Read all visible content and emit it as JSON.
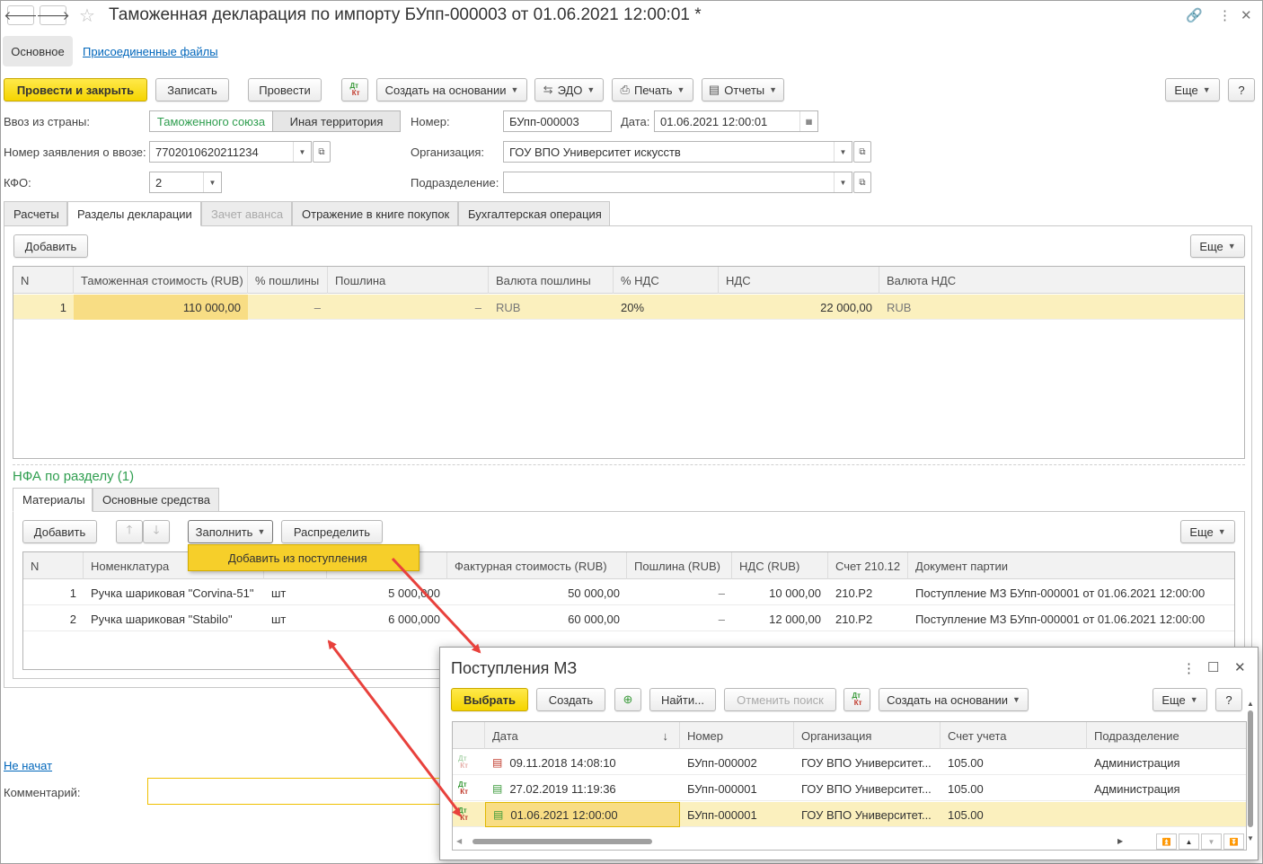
{
  "window": {
    "title": "Таможенная декларация по импорту БУпп-000003 от 01.06.2021 12:00:01 *"
  },
  "nav": {
    "back_glyph": "🡐",
    "forward_glyph": "🡒",
    "star_glyph": "☆",
    "link_glyph": "🔗",
    "menu_glyph": "⋮",
    "maximize_glyph": "☐",
    "close_glyph": "✕"
  },
  "form_tabs": {
    "main": "Основное",
    "files": "Присоединенные файлы"
  },
  "toolbar": {
    "post_close": "Провести и закрыть",
    "save": "Записать",
    "post": "Провести",
    "dtkt": "Дт Кт",
    "create_based": "Создать на основании",
    "edo": "ЭДО",
    "print": "Печать",
    "reports": "Отчеты",
    "more": "Еще",
    "help": "?"
  },
  "fields": {
    "import_country_label": "Ввоз из страны:",
    "customs_union": "Таможенного союза",
    "other_territory": "Иная территория",
    "application_label": "Номер заявления о ввозе:",
    "application_value": "7702010620211234",
    "kfo_label": "КФО:",
    "kfo_value": "2",
    "number_label": "Номер:",
    "number_value": "БУпп-000003",
    "date_label": "Дата:",
    "date_value": "01.06.2021 12:00:01",
    "org_label": "Организация:",
    "org_value": "ГОУ ВПО Университет искусств",
    "dept_label": "Подразделение:",
    "dept_value": ""
  },
  "tabs": [
    "Расчеты",
    "Разделы декларации",
    "Зачет аванса",
    "Отражение в книге покупок",
    "Бухгалтерская операция"
  ],
  "sections": {
    "add": "Добавить",
    "more": "Еще",
    "columns": [
      "N",
      "Таможенная стоимость (RUB)",
      "% пошлины",
      "Пошлина",
      "Валюта пошлины",
      "% НДС",
      "НДС",
      "Валюта НДС"
    ],
    "rows": [
      {
        "n": "1",
        "value": "110 000,00",
        "duty_pct": "–",
        "duty": "–",
        "duty_cur": "RUB",
        "vat_pct": "20%",
        "vat": "22 000,00",
        "vat_cur": "RUB"
      }
    ]
  },
  "nfa": {
    "title": "НФА по разделу (1)",
    "tabs": [
      "Материалы",
      "Основные средства"
    ],
    "add": "Добавить",
    "fill": "Заполнить",
    "distribute": "Распределить",
    "more": "Еще",
    "fill_menu_item": "Добавить из поступления",
    "columns": [
      "N",
      "Номенклатура",
      "",
      "",
      "Фактурная стоимость (RUB)",
      "Пошлина (RUB)",
      "НДС (RUB)",
      "Счет 210.12",
      "Документ партии"
    ],
    "rows": [
      {
        "n": "1",
        "name": "Ручка шариковая \"Corvina-51\"",
        "unit": "шт",
        "qty": "5 000,000",
        "invoice": "50 000,00",
        "duty": "–",
        "vat": "10 000,00",
        "account": "210.Р2",
        "doc": "Поступление МЗ БУпп-000001 от 01.06.2021 12:00:00"
      },
      {
        "n": "2",
        "name": "Ручка шариковая \"Stabilo\"",
        "unit": "шт",
        "qty": "6 000,000",
        "invoice": "60 000,00",
        "duty": "–",
        "vat": "12 000,00",
        "account": "210.Р2",
        "doc": "Поступление МЗ БУпп-000001 от 01.06.2021 12:00:00"
      }
    ]
  },
  "footer": {
    "status_link": "Не начат",
    "comment_label": "Комментарий:",
    "comment_value": ""
  },
  "popup": {
    "title": "Поступления МЗ",
    "select": "Выбрать",
    "create": "Создать",
    "find": "Найти...",
    "cancel_search": "Отменить поиск",
    "create_based": "Создать на основании",
    "more": "Еще",
    "help": "?",
    "sort_arrow": "↓",
    "columns": [
      "Дата",
      "Номер",
      "Организация",
      "Счет учета",
      "Подразделение"
    ],
    "rows": [
      {
        "date": "09.11.2018 14:08:10",
        "number": "БУпп-000002",
        "org": "ГОУ ВПО Университет...",
        "account": "105.00",
        "dept": "Администрация",
        "posted": false
      },
      {
        "date": "27.02.2019 11:19:36",
        "number": "БУпп-000001",
        "org": "ГОУ ВПО Университет...",
        "account": "105.00",
        "dept": "Администрация",
        "posted": true
      },
      {
        "date": "01.06.2021 12:00:00",
        "number": "БУпп-000001",
        "org": "ГОУ ВПО Университет...",
        "account": "105.00",
        "dept": "",
        "posted": true
      }
    ]
  },
  "colors": {
    "accent_yellow": "#f5d400",
    "selected_row": "#fbf0be",
    "selected_cell": "#f8dd84",
    "link": "#0066bb",
    "section_green": "#2f9e4f",
    "annotation_red": "#e8413c"
  }
}
